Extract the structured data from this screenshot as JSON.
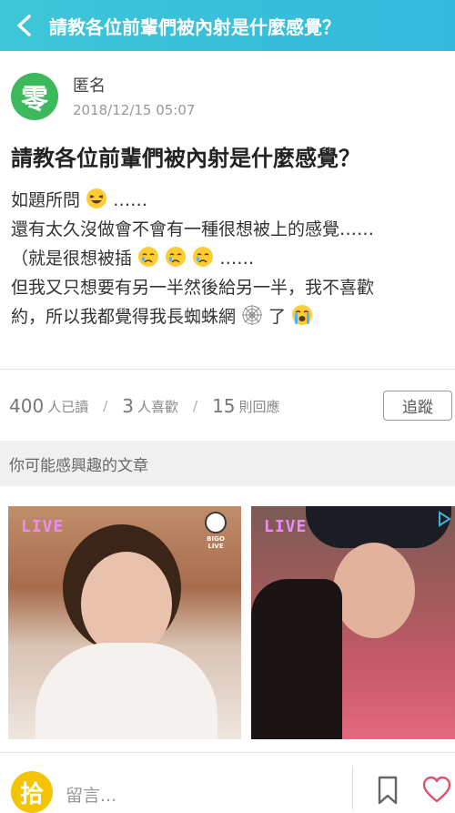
{
  "header": {
    "title": "請教各位前輩們被內射是什麼感覺？"
  },
  "author": {
    "avatar_char": "零",
    "name": "匿名",
    "date": "2018/12/15 05:07"
  },
  "post": {
    "title": "請教各位前輩們被內射是什麼感覺？",
    "line1_a": "如題所問",
    "line1_b": "……",
    "line2": "還有太久沒做會不會有一種很想被上的感覺……",
    "line3_a": "（就是很想被插",
    "line3_b": "……",
    "line4": "但我又只想要有另一半然後給另一半，我不喜歡",
    "line5_a": "約，所以我都覺得我長蜘蛛網",
    "line5_b": "了"
  },
  "stats": {
    "reads_num": "400",
    "reads_label": "人已讀",
    "likes_num": "3",
    "likes_label": "人喜歡",
    "replies_num": "15",
    "replies_label": "則回應",
    "separator": "/",
    "follow_label": "追蹤"
  },
  "related": {
    "heading": "你可能感興趣的文章",
    "cards": [
      {
        "live_label": "LIVE",
        "brand": "BIGO LIVE"
      },
      {
        "live_label": "LIVE"
      }
    ]
  },
  "bottom": {
    "avatar_char": "拾",
    "comment_placeholder": "留言..."
  },
  "colors": {
    "header_bg": "#3fc6d8",
    "author_avatar": "#3cb85d",
    "bottom_avatar": "#f5c400",
    "live_text": "#e98df6"
  },
  "icons": [
    "back-icon",
    "laughing-emoji-icon",
    "crying-emoji-icon",
    "spiderweb-emoji-icon",
    "sobbing-emoji-icon",
    "bookmark-icon",
    "heart-icon",
    "ad-choices-icon",
    "bigo-logo-icon"
  ]
}
